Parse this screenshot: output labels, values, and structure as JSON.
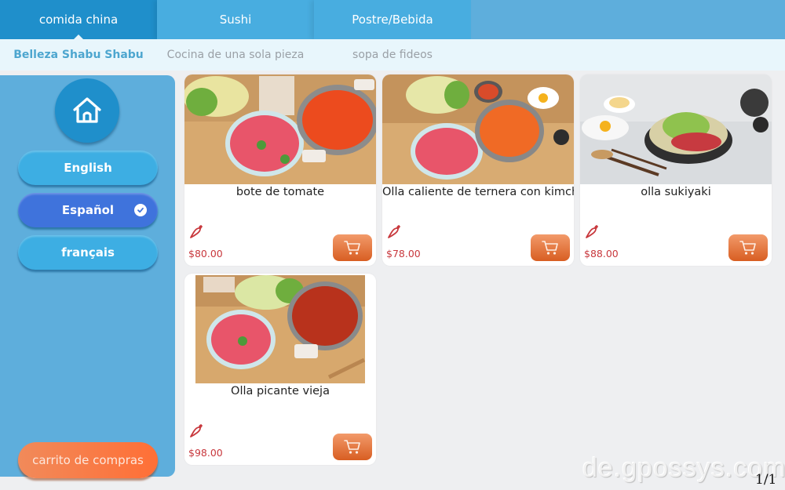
{
  "top_tabs": [
    {
      "label": "comida china",
      "active": true
    },
    {
      "label": "Sushi",
      "active": false
    },
    {
      "label": "Postre/Bebida",
      "active": false
    }
  ],
  "sub_tabs": [
    {
      "label": "Belleza Shabu Shabu",
      "active": true
    },
    {
      "label": "Cocina de una sola pieza",
      "active": false
    },
    {
      "label": "sopa de fideos",
      "active": false
    }
  ],
  "sidebar": {
    "home_icon": "home-icon",
    "languages": [
      {
        "label": "English",
        "selected": false
      },
      {
        "label": "Español",
        "selected": true
      },
      {
        "label": "français",
        "selected": false
      }
    ],
    "cart_label": "carrito de compras"
  },
  "products": [
    {
      "name": "bote de tomate",
      "price": "$80.00",
      "spicy_icon": "chili-icon",
      "image": "tomato hot pot with sliced beef and vegetables"
    },
    {
      "name": "Olla caliente de ternera con kimchi",
      "price": "$78.00",
      "spicy_icon": "chili-icon",
      "image": "kimchi beef hot pot with egg"
    },
    {
      "name": "olla sukiyaki",
      "price": "$88.00",
      "spicy_icon": "chili-icon",
      "image": "sukiyaki pot with beef and cabbage"
    },
    {
      "name": "Olla picante vieja",
      "price": "$98.00",
      "spicy_icon": "chili-icon",
      "image": "spicy red broth hot pot with sliced beef"
    }
  ],
  "pager": "1/1",
  "watermark": "de.gpossys.com",
  "colors": {
    "tab_active": "#1f8fcb",
    "tab": "#48ade0",
    "sidebar": "#5eaedc",
    "language_selected": "#3f73dc",
    "cart_orange": "#ff6f36",
    "price_red": "#c8383d"
  }
}
